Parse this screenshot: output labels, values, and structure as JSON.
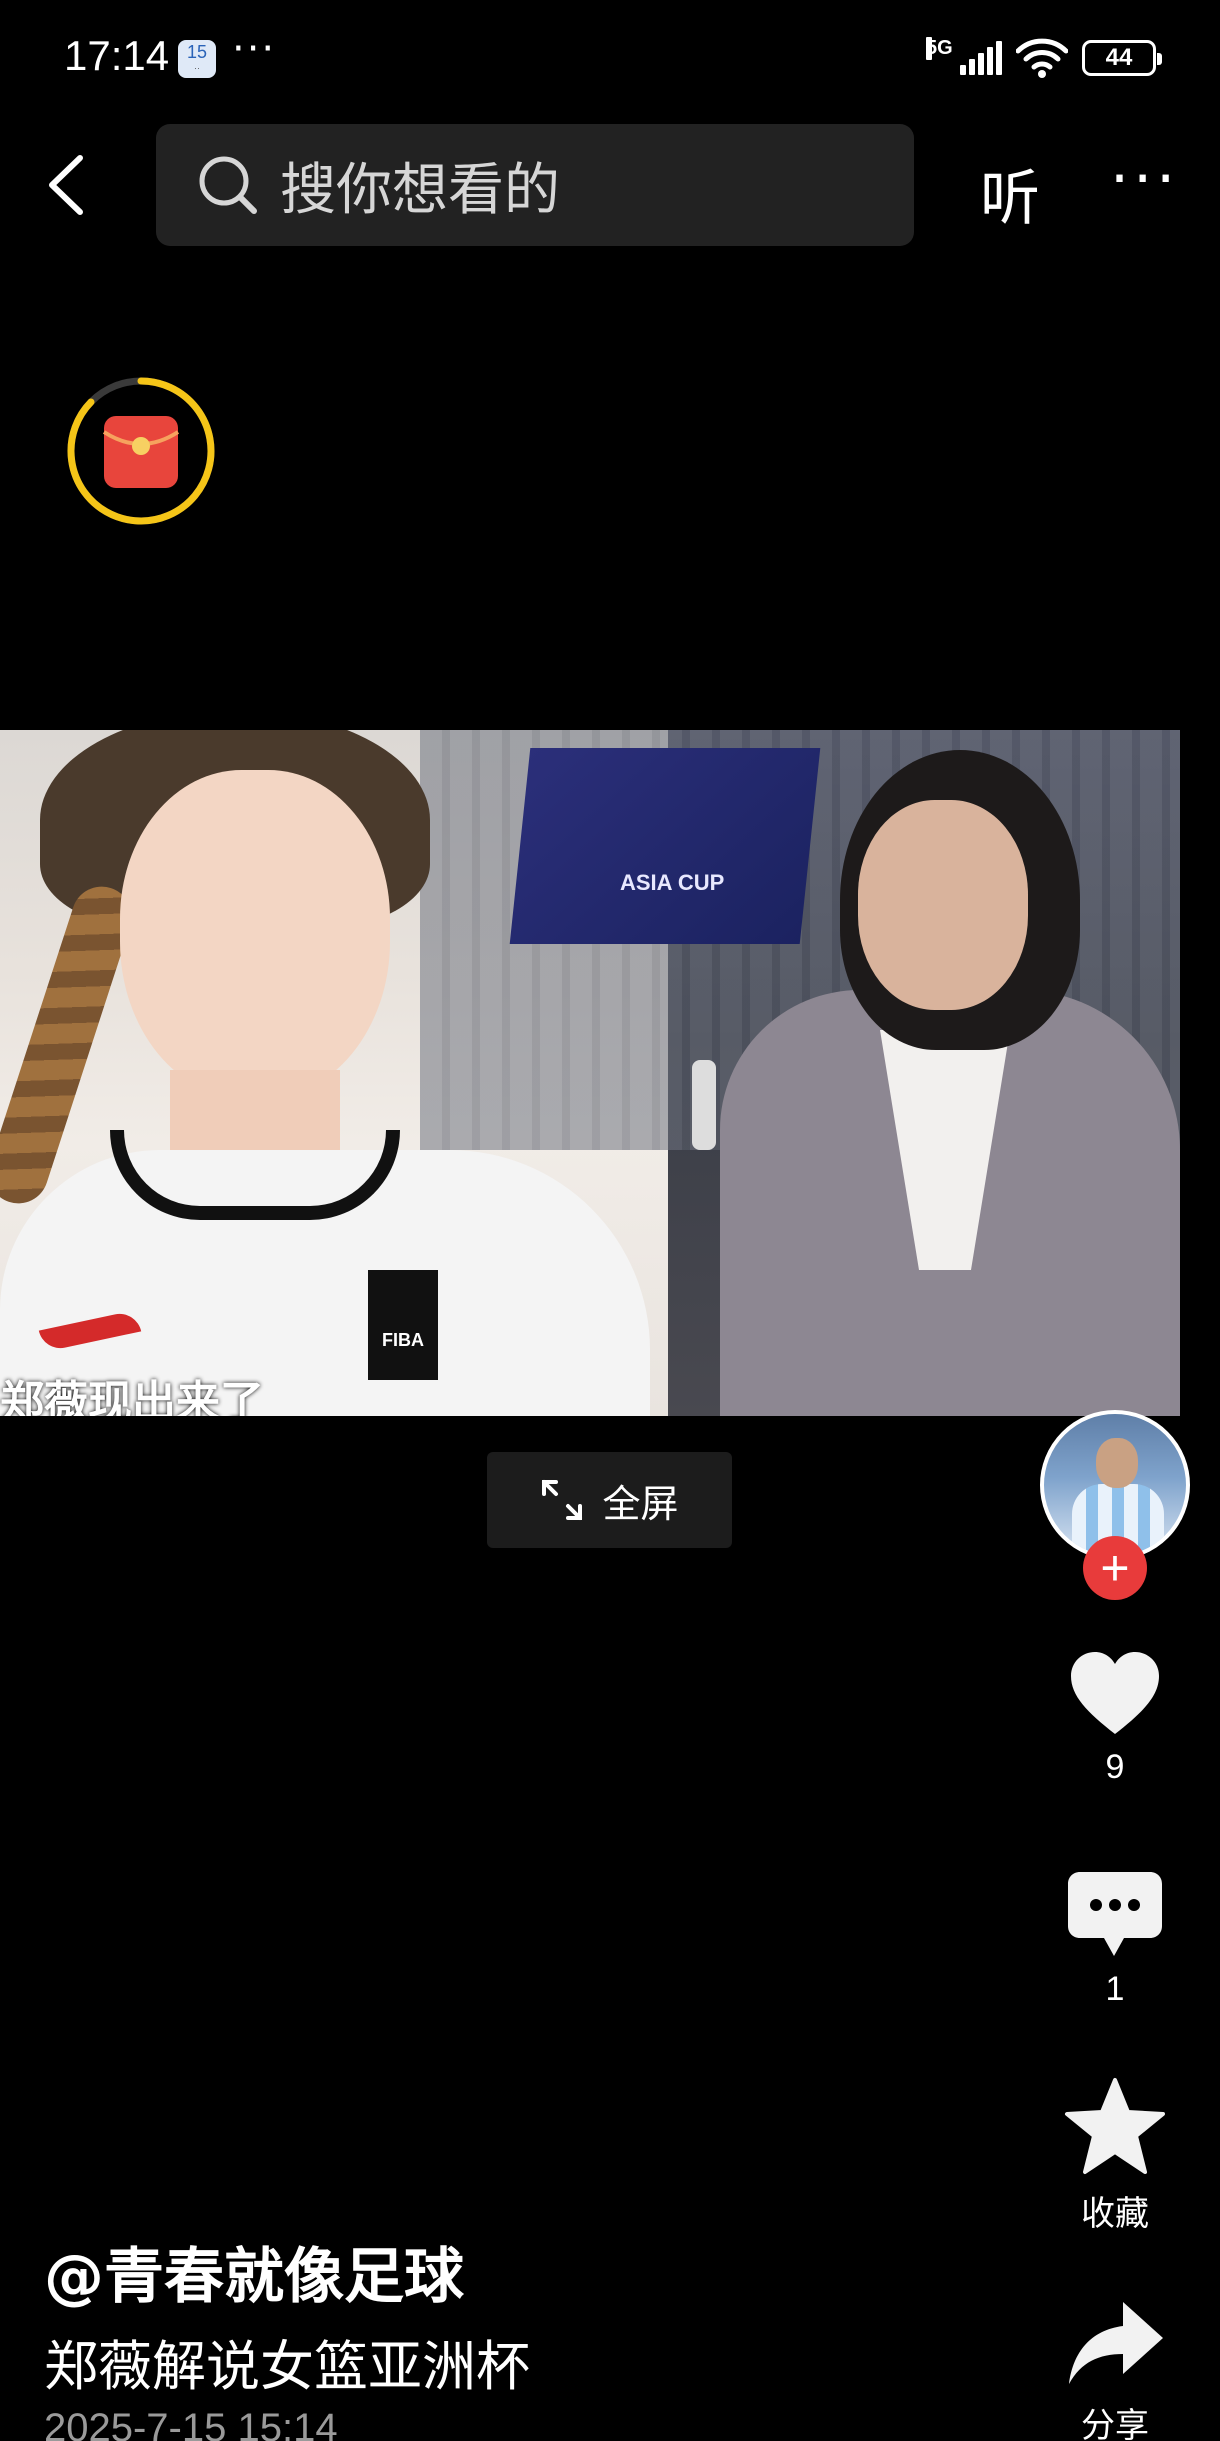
{
  "status_bar": {
    "time": "17:14",
    "calendar_day": "15",
    "more": "···",
    "network": "5G",
    "battery": "44"
  },
  "nav": {
    "search_placeholder": "搜你想看的",
    "listen_label": "听",
    "more_label": "···"
  },
  "video": {
    "banner_text": "ASIA CUP",
    "jersey_logo": "FIBA",
    "caption_fragment": "郑薇现出来了"
  },
  "fullscreen": {
    "label": "全屏"
  },
  "actions": {
    "follow": "+",
    "like_count": "9",
    "comment_count": "1",
    "favorite_label": "收藏",
    "share_label": "分享"
  },
  "post": {
    "author": "@青春就像足球",
    "description": "郑薇解说女篮亚洲杯",
    "date": "2025-7-15 15:14"
  },
  "colors": {
    "background": "#000000",
    "search_bg": "#222222",
    "follow_red": "#e83b3b",
    "redpacket_ring": "#f5c518",
    "redpacket_body": "#e8453c"
  }
}
